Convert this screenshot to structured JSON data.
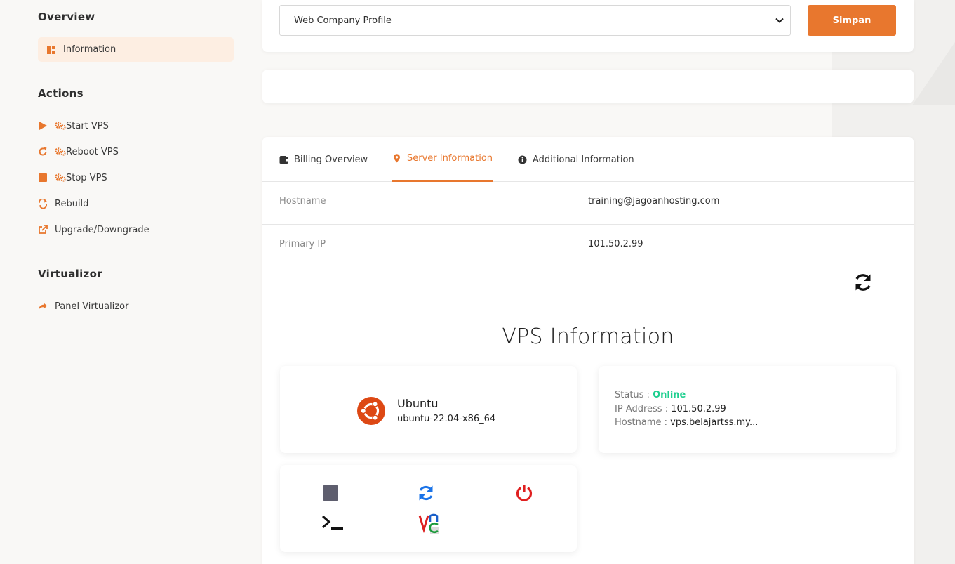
{
  "sidebar": {
    "overview_heading": "Overview",
    "active_item": {
      "label": "Information",
      "icon": "dashboard-icon"
    },
    "actions_heading": "Actions",
    "actions": [
      {
        "label": "Start VPS",
        "icon": "play-icon"
      },
      {
        "label": "Reboot VPS",
        "icon": "rotate-icon"
      },
      {
        "label": "Stop VPS",
        "icon": "stop-icon"
      },
      {
        "label": "Rebuild",
        "icon": "exchange-icon"
      },
      {
        "label": "Upgrade/Downgrade",
        "icon": "external-link-icon"
      }
    ],
    "virtualizor_heading": "Virtualizor",
    "virtualizor_items": [
      {
        "label": "Panel Virtualizor",
        "icon": "share-arrow-icon"
      }
    ]
  },
  "top": {
    "select_value": "Web Company Profile",
    "save_label": "Simpan"
  },
  "tabs": [
    {
      "label": "Billing Overview",
      "icon": "wallet-icon"
    },
    {
      "label": "Server Information",
      "icon": "map-pin-icon",
      "active": true
    },
    {
      "label": "Additional Information",
      "icon": "info-circle-icon"
    }
  ],
  "server_info": {
    "hostname_label": "Hostname",
    "hostname_value": "training@jagoanhosting.com",
    "ip_label": "Primary IP",
    "ip_value": "101.50.2.99"
  },
  "vps": {
    "title": "VPS Information",
    "os_name": "Ubuntu",
    "os_version": "ubuntu-22.04-x86_64",
    "status_label": "Status :",
    "status_value": "Online",
    "ip_label": "IP Address :",
    "ip_value": "101.50.2.99",
    "hostname_label": "Hostname :",
    "hostname_value": "vps.belajartss.my..."
  },
  "colors": {
    "accent": "#e8772e",
    "online": "#1ecf8f",
    "power": "#e02020",
    "restart": "#1a73e8",
    "stop": "#5e5e6e"
  }
}
